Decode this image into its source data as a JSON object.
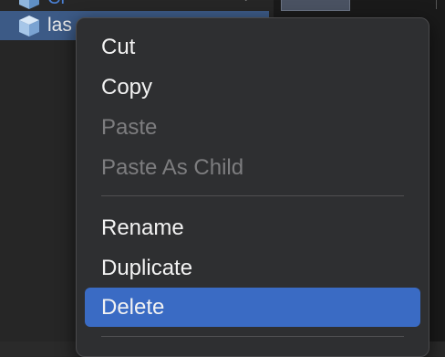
{
  "hierarchy": {
    "partial_row_label": "Cr",
    "selected_row_label": "las"
  },
  "menu": {
    "items": [
      {
        "label": "Cut",
        "enabled": true
      },
      {
        "label": "Copy",
        "enabled": true
      },
      {
        "label": "Paste",
        "enabled": false
      },
      {
        "label": "Paste As Child",
        "enabled": false
      },
      {
        "label": "Rename",
        "enabled": true
      },
      {
        "label": "Duplicate",
        "enabled": true
      },
      {
        "label": "Delete",
        "enabled": true,
        "highlighted": true
      }
    ]
  },
  "colors": {
    "selection": "#3c5a86",
    "menu_highlight": "#3a6bc4",
    "cube_icon": "#7fb2e6"
  }
}
